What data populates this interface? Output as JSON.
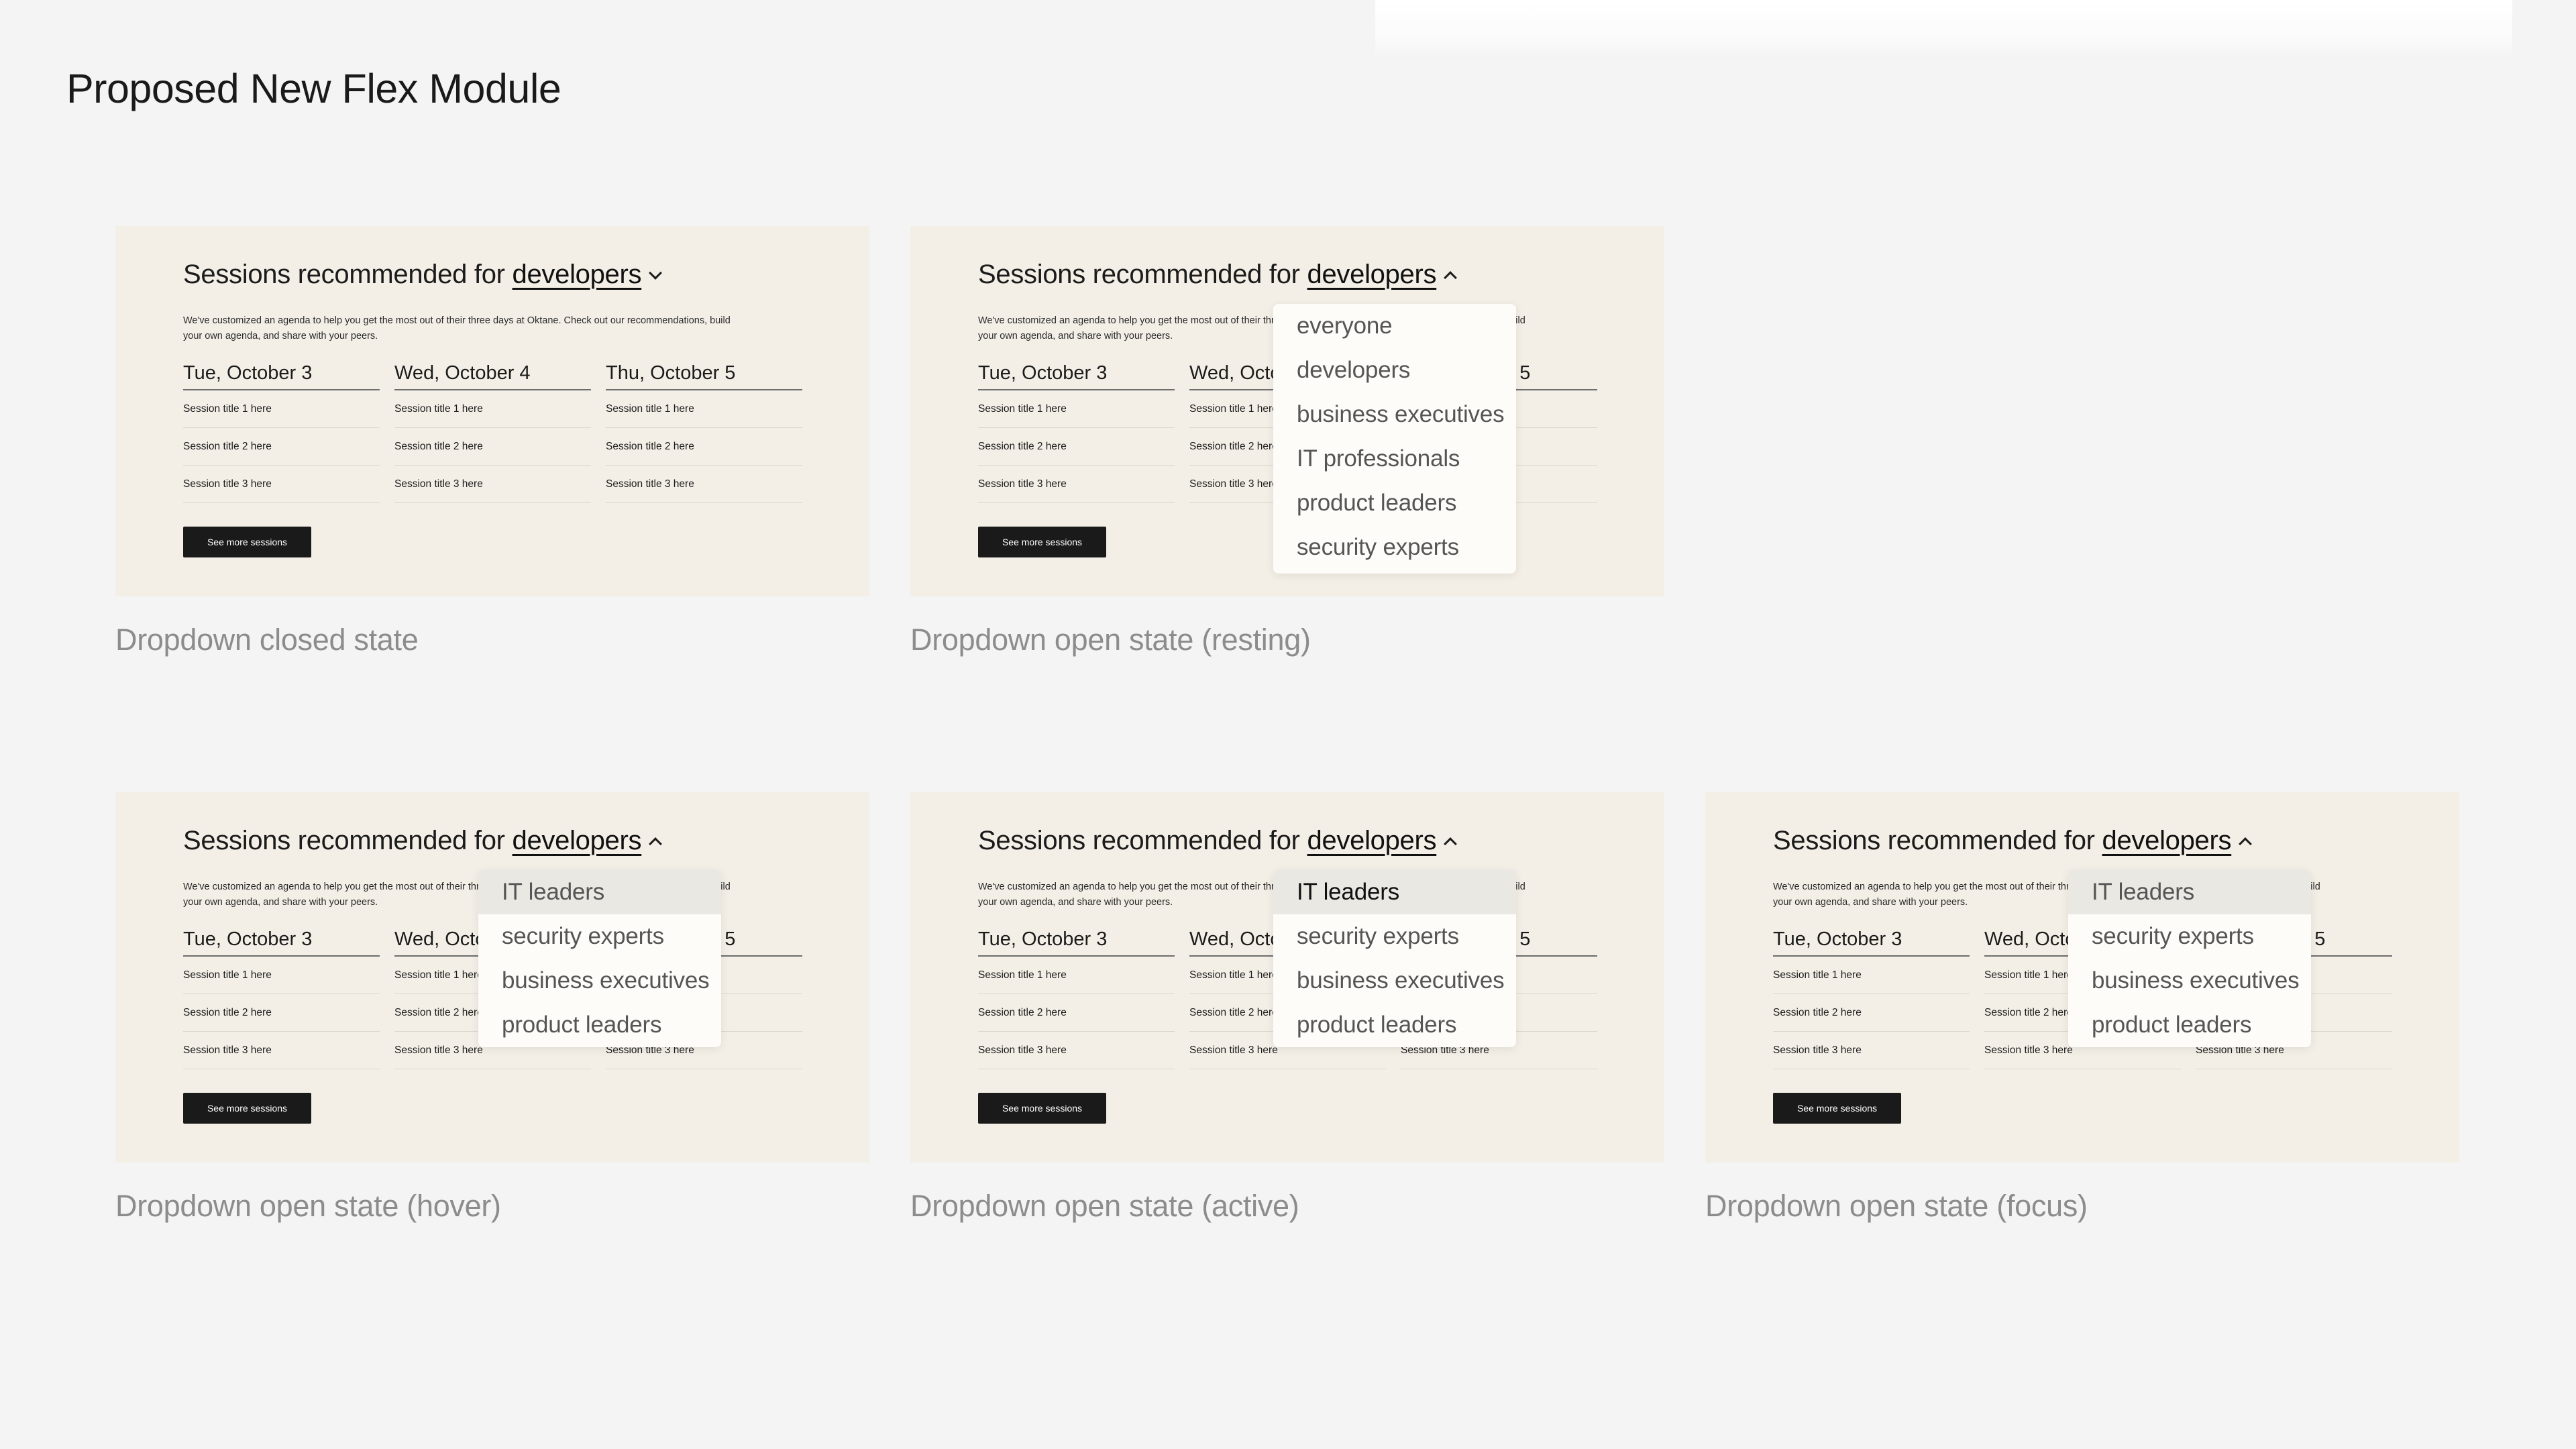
{
  "page_title": "Proposed New Flex Module",
  "module": {
    "heading_prefix": "Sessions recommended for",
    "selected": "developers",
    "description": "We've customized an agenda to help you get the most out of their three days at Oktane. Check out our recommendations, build your own agenda, and share with your peers.",
    "days": [
      {
        "date": "Tue, October 3",
        "sessions": [
          "Session title 1 here",
          "Session title 2 here",
          "Session title 3 here"
        ]
      },
      {
        "date": "Wed, October 4",
        "sessions": [
          "Session title 1 here",
          "Session title 2 here",
          "Session title 3 here"
        ]
      },
      {
        "date": "Thu, October 5",
        "sessions": [
          "Session title 1 here",
          "Session title 2 here",
          "Session title 3 here"
        ]
      }
    ],
    "button_label": "See more sessions"
  },
  "dropdown_full": [
    "everyone",
    "developers",
    "business executives",
    "IT professionals",
    "product leaders",
    "security experts"
  ],
  "dropdown_short": [
    "IT leaders",
    "security experts",
    "business executives",
    "product leaders"
  ],
  "captions": {
    "closed": "Dropdown closed state",
    "resting": "Dropdown open state (resting)",
    "hover": "Dropdown open state (hover)",
    "active": "Dropdown open state (active)",
    "focus": "Dropdown open state (focus)"
  }
}
